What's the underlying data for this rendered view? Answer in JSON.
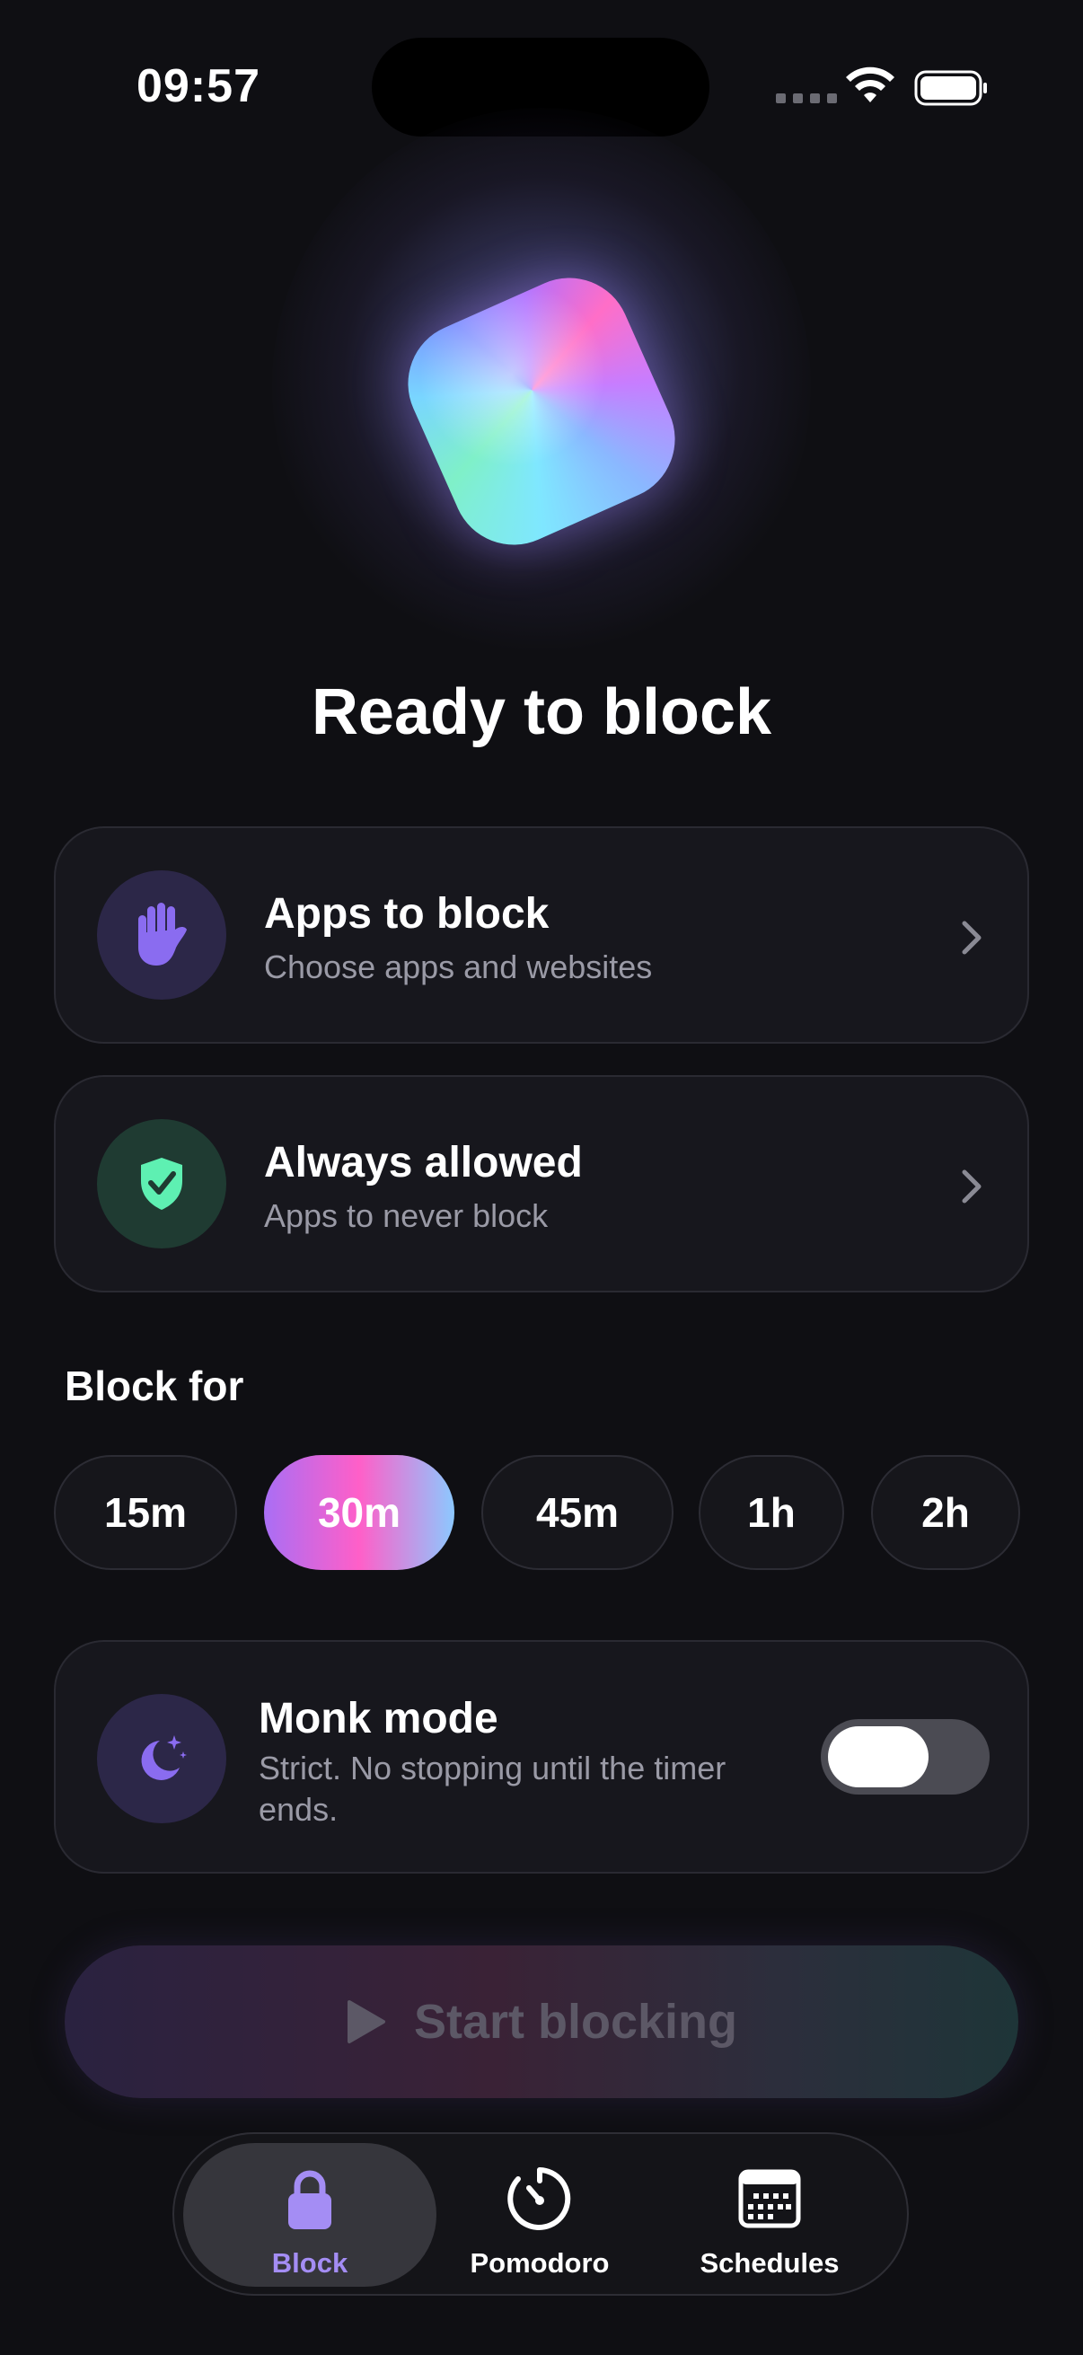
{
  "status_bar": {
    "time": "09:57"
  },
  "hero": {
    "title": "Ready to block"
  },
  "cards": {
    "apps": {
      "title": "Apps to block",
      "subtitle": "Choose apps and websites",
      "icon": "hand-raised-icon"
    },
    "allowed": {
      "title": "Always allowed",
      "subtitle": "Apps to never block",
      "icon": "shield-check-icon"
    }
  },
  "duration": {
    "label": "Block for",
    "options": [
      "15m",
      "30m",
      "45m",
      "1h",
      "2h"
    ],
    "selected": "30m"
  },
  "monk_mode": {
    "title": "Monk mode",
    "subtitle": "Strict. No stopping until the timer ends.",
    "enabled": true,
    "icon": "moon-stars-icon"
  },
  "start_button": {
    "label": "Start blocking",
    "enabled": false
  },
  "tabs": [
    {
      "label": "Block",
      "icon": "lock-icon",
      "active": true
    },
    {
      "label": "Pomodoro",
      "icon": "timer-icon",
      "active": false
    },
    {
      "label": "Schedules",
      "icon": "calendar-icon",
      "active": false
    }
  ],
  "colors": {
    "accent": "#a48df4",
    "background": "#0f0f13",
    "card": "#17171d"
  }
}
